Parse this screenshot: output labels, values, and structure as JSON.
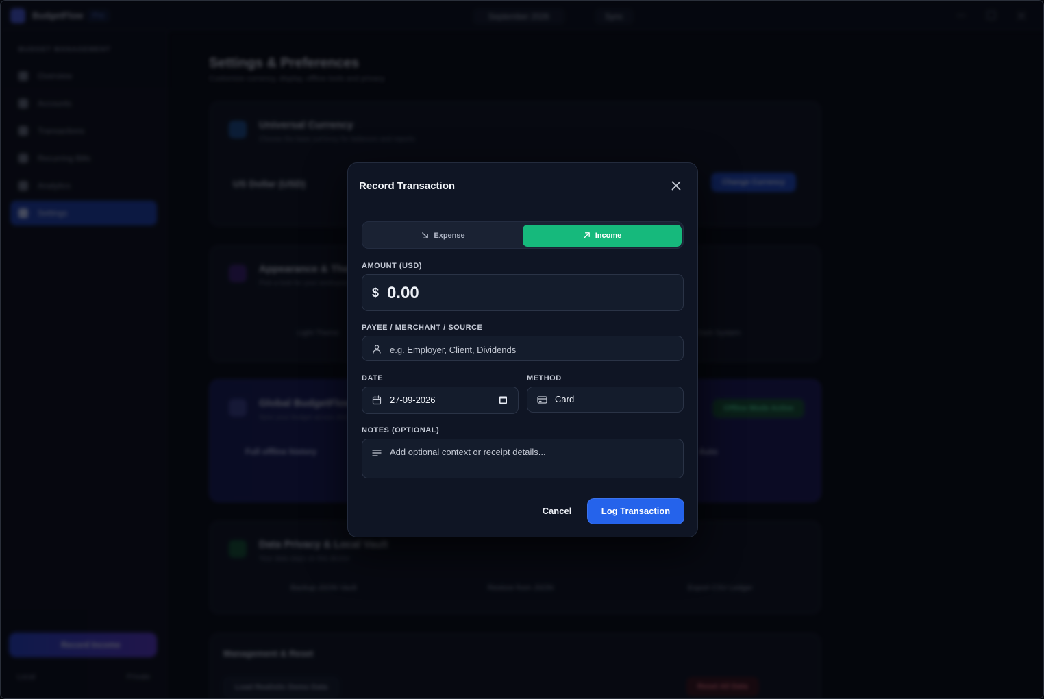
{
  "background": {
    "app_name": "BudgetFlow",
    "app_version": "Pro",
    "header_month": "September 2026",
    "header_chip": "Sync",
    "sidebar_heading": "BUDGET MANAGEMENT",
    "sidebar_items": [
      {
        "label": "Overview"
      },
      {
        "label": "Accounts"
      },
      {
        "label": "Transactions"
      },
      {
        "label": "Recurring Bills"
      },
      {
        "label": "Analytics"
      },
      {
        "label": "Settings"
      }
    ],
    "sidebar_cta": "Record Income",
    "sidebar_footer_left": "Local",
    "sidebar_footer_right": "Private",
    "page_title": "Settings & Preferences",
    "page_subtitle": "Customize currency, display, offline tools and privacy",
    "cards": [
      {
        "title": "Universal Currency",
        "subtitle": "Choose the base currency for balances and reports",
        "value": "US Dollar (USD)",
        "button": "Change Currency"
      },
      {
        "title": "Appearance & Themes",
        "subtitle": "Pick a look for your workspace",
        "option_left": "Light Theme",
        "option_right": "Dark System"
      },
      {
        "title": "Global BudgetFlow",
        "subtitle": "Sync your budget across devices",
        "badge": "Offline Mode Active",
        "feature_left": "Full offline history",
        "feature_right": "Auto"
      },
      {
        "title": "Data Privacy & Local Vault",
        "subtitle": "Your data stays on this device",
        "action_1": "Backup JSON Vault",
        "action_2": "Restore from JSON",
        "action_3": "Export CSV Ledger"
      },
      {
        "title": "Management & Reset",
        "action_left": "Load Realistic Demo Data",
        "action_right": "Reset All Data"
      }
    ]
  },
  "modal": {
    "title": "Record Transaction",
    "type_toggle": {
      "expense_label": "Expense",
      "income_label": "Income",
      "selected": "Income"
    },
    "amount": {
      "label": "AMOUNT (USD)",
      "currency_symbol": "$",
      "placeholder": "0.00"
    },
    "payee": {
      "label": "PAYEE / MERCHANT / SOURCE",
      "placeholder": "e.g. Employer, Client, Dividends"
    },
    "date": {
      "label": "DATE",
      "value": "27-09-2026"
    },
    "method": {
      "label": "METHOD",
      "value": "Card"
    },
    "notes": {
      "label": "NOTES (OPTIONAL)",
      "placeholder": "Add optional context or receipt details..."
    },
    "cancel_label": "Cancel",
    "submit_label": "Log Transaction"
  },
  "colors": {
    "income_accent": "#16b97c",
    "primary_button": "#2563eb",
    "modal_bg": "#0f1524"
  }
}
